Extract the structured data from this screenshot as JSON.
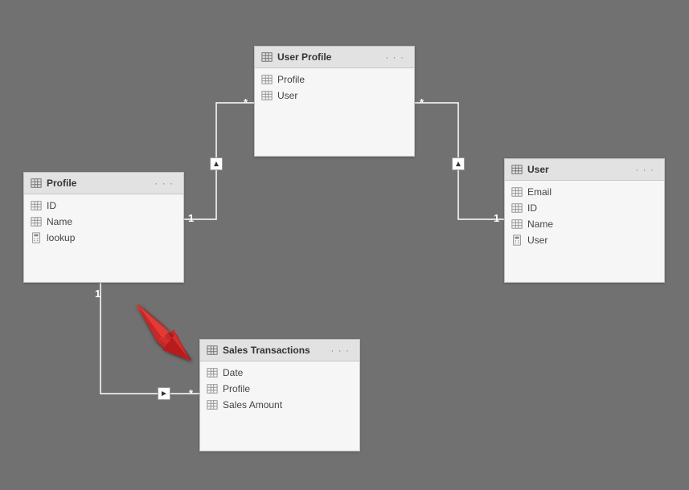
{
  "tables": {
    "profile": {
      "title": "Profile",
      "fields": [
        {
          "name": "ID",
          "icon": "column"
        },
        {
          "name": "Name",
          "icon": "column"
        },
        {
          "name": "lookup",
          "icon": "calc"
        }
      ]
    },
    "userprofile": {
      "title": "User Profile",
      "fields": [
        {
          "name": "Profile",
          "icon": "column"
        },
        {
          "name": "User",
          "icon": "column"
        }
      ]
    },
    "user": {
      "title": "User",
      "fields": [
        {
          "name": "Email",
          "icon": "column"
        },
        {
          "name": "ID",
          "icon": "column"
        },
        {
          "name": "Name",
          "icon": "column"
        },
        {
          "name": "User",
          "icon": "calc"
        }
      ]
    },
    "sales": {
      "title": "Sales Transactions",
      "fields": [
        {
          "name": "Date",
          "icon": "column"
        },
        {
          "name": "Profile",
          "icon": "column"
        },
        {
          "name": "Sales Amount",
          "icon": "column"
        }
      ]
    }
  },
  "relationships": {
    "profile_userprofile": {
      "from_card": "1",
      "to_card": "*"
    },
    "user_userprofile": {
      "from_card": "1",
      "to_card": "*"
    },
    "profile_sales": {
      "from_card": "1",
      "to_card": "*"
    }
  },
  "ellipsis": "· · ·"
}
